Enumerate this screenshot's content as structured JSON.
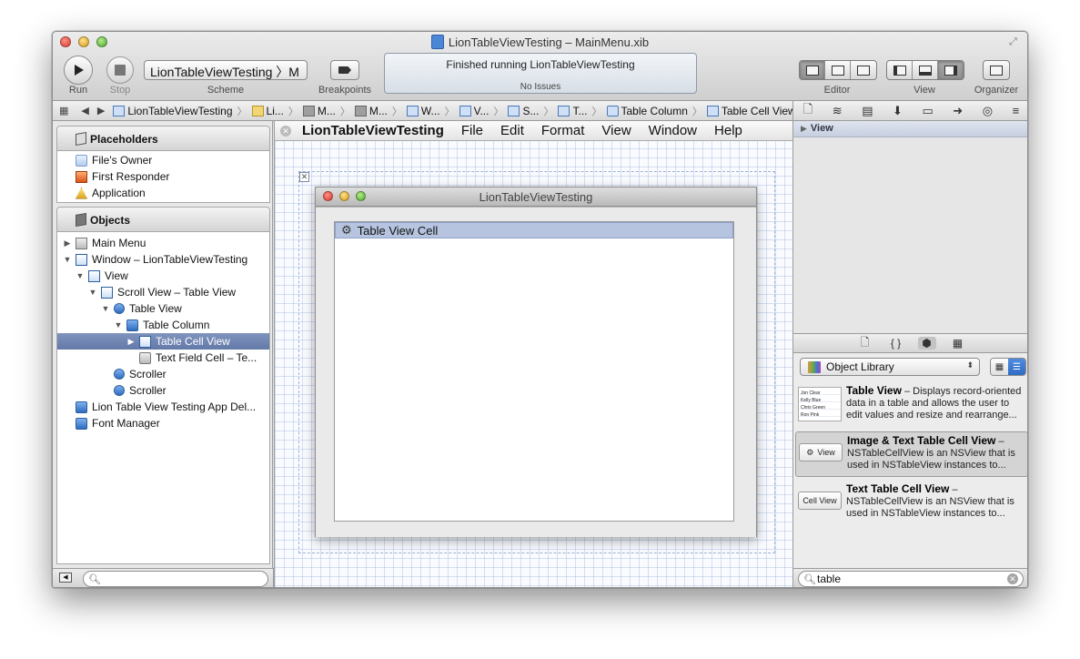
{
  "window": {
    "title": "LionTableViewTesting – MainMenu.xib"
  },
  "toolbar": {
    "run_label": "Run",
    "stop_label": "Stop",
    "scheme_value": "LionTableViewTesting 〉M",
    "scheme_label": "Scheme",
    "breakpoints_label": "Breakpoints",
    "activity_main": "Finished running LionTableViewTesting",
    "activity_sub": "No Issues",
    "editor_label": "Editor",
    "view_label": "View",
    "organizer_label": "Organizer"
  },
  "jumpbar": {
    "items": [
      "LionTableViewTesting",
      "Li...",
      "M...",
      "M...",
      "W...",
      "V...",
      "S...",
      "T...",
      "Table Column",
      "Table Cell View"
    ]
  },
  "navigator": {
    "placeholders_title": "Placeholders",
    "placeholders": [
      "File's Owner",
      "First Responder",
      "Application"
    ],
    "objects_title": "Objects",
    "objects": [
      {
        "label": "Main Menu",
        "depth": 0,
        "disclosure": "▶",
        "icon": "menu-icon"
      },
      {
        "label": "Window – LionTableViewTesting",
        "depth": 0,
        "disclosure": "▼",
        "icon": "window-icon"
      },
      {
        "label": "View",
        "depth": 1,
        "disclosure": "▼",
        "icon": "view-icon"
      },
      {
        "label": "Scroll View – Table View",
        "depth": 2,
        "disclosure": "▼",
        "icon": "scroll-view-icon"
      },
      {
        "label": "Table View",
        "depth": 3,
        "disclosure": "▼",
        "icon": "table-view-icon"
      },
      {
        "label": "Table Column",
        "depth": 4,
        "disclosure": "▼",
        "icon": "table-column-icon"
      },
      {
        "label": "Table Cell View",
        "depth": 5,
        "disclosure": "▶",
        "icon": "table-cell-view-icon",
        "selected": true
      },
      {
        "label": "Text Field Cell – Te...",
        "depth": 5,
        "disclosure": "",
        "icon": "text-field-cell-icon"
      },
      {
        "label": "Scroller",
        "depth": 3,
        "disclosure": "",
        "icon": "scroller-icon"
      },
      {
        "label": "Scroller",
        "depth": 3,
        "disclosure": "",
        "icon": "scroller-icon"
      },
      {
        "label": "Lion Table View Testing App Del...",
        "depth": 0,
        "disclosure": "",
        "icon": "app-delegate-icon"
      },
      {
        "label": "Font Manager",
        "depth": 0,
        "disclosure": "",
        "icon": "font-manager-icon"
      }
    ],
    "filter_placeholder": ""
  },
  "menubar": {
    "app": "LionTableViewTesting",
    "items": [
      "File",
      "Edit",
      "Format",
      "View",
      "Window",
      "Help"
    ]
  },
  "canvas": {
    "window_title": "LionTableViewTesting",
    "cell_label": "Table View Cell"
  },
  "inspector": {
    "section": "View"
  },
  "library": {
    "selector": "Object Library",
    "items": [
      {
        "title": "Table View",
        "desc": " – Displays record-oriented data in a table and allows the user to edit values and resize and rearrange...",
        "thumb": ""
      },
      {
        "title": "Image & Text Table Cell View",
        "desc": " – NSTableCellView is an NSView that is used in NSTableView instances to...",
        "thumb": "View"
      },
      {
        "title": "Text Table Cell View",
        "desc": " – NSTableCellView is an NSView that is used in NSTableView instances to...",
        "thumb": "Cell View"
      }
    ],
    "table_thumb_rows": [
      "Jon   Clear",
      "Kelly  Blue",
      "Chris  Green",
      "Ron   Pink"
    ],
    "search_value": "table"
  }
}
